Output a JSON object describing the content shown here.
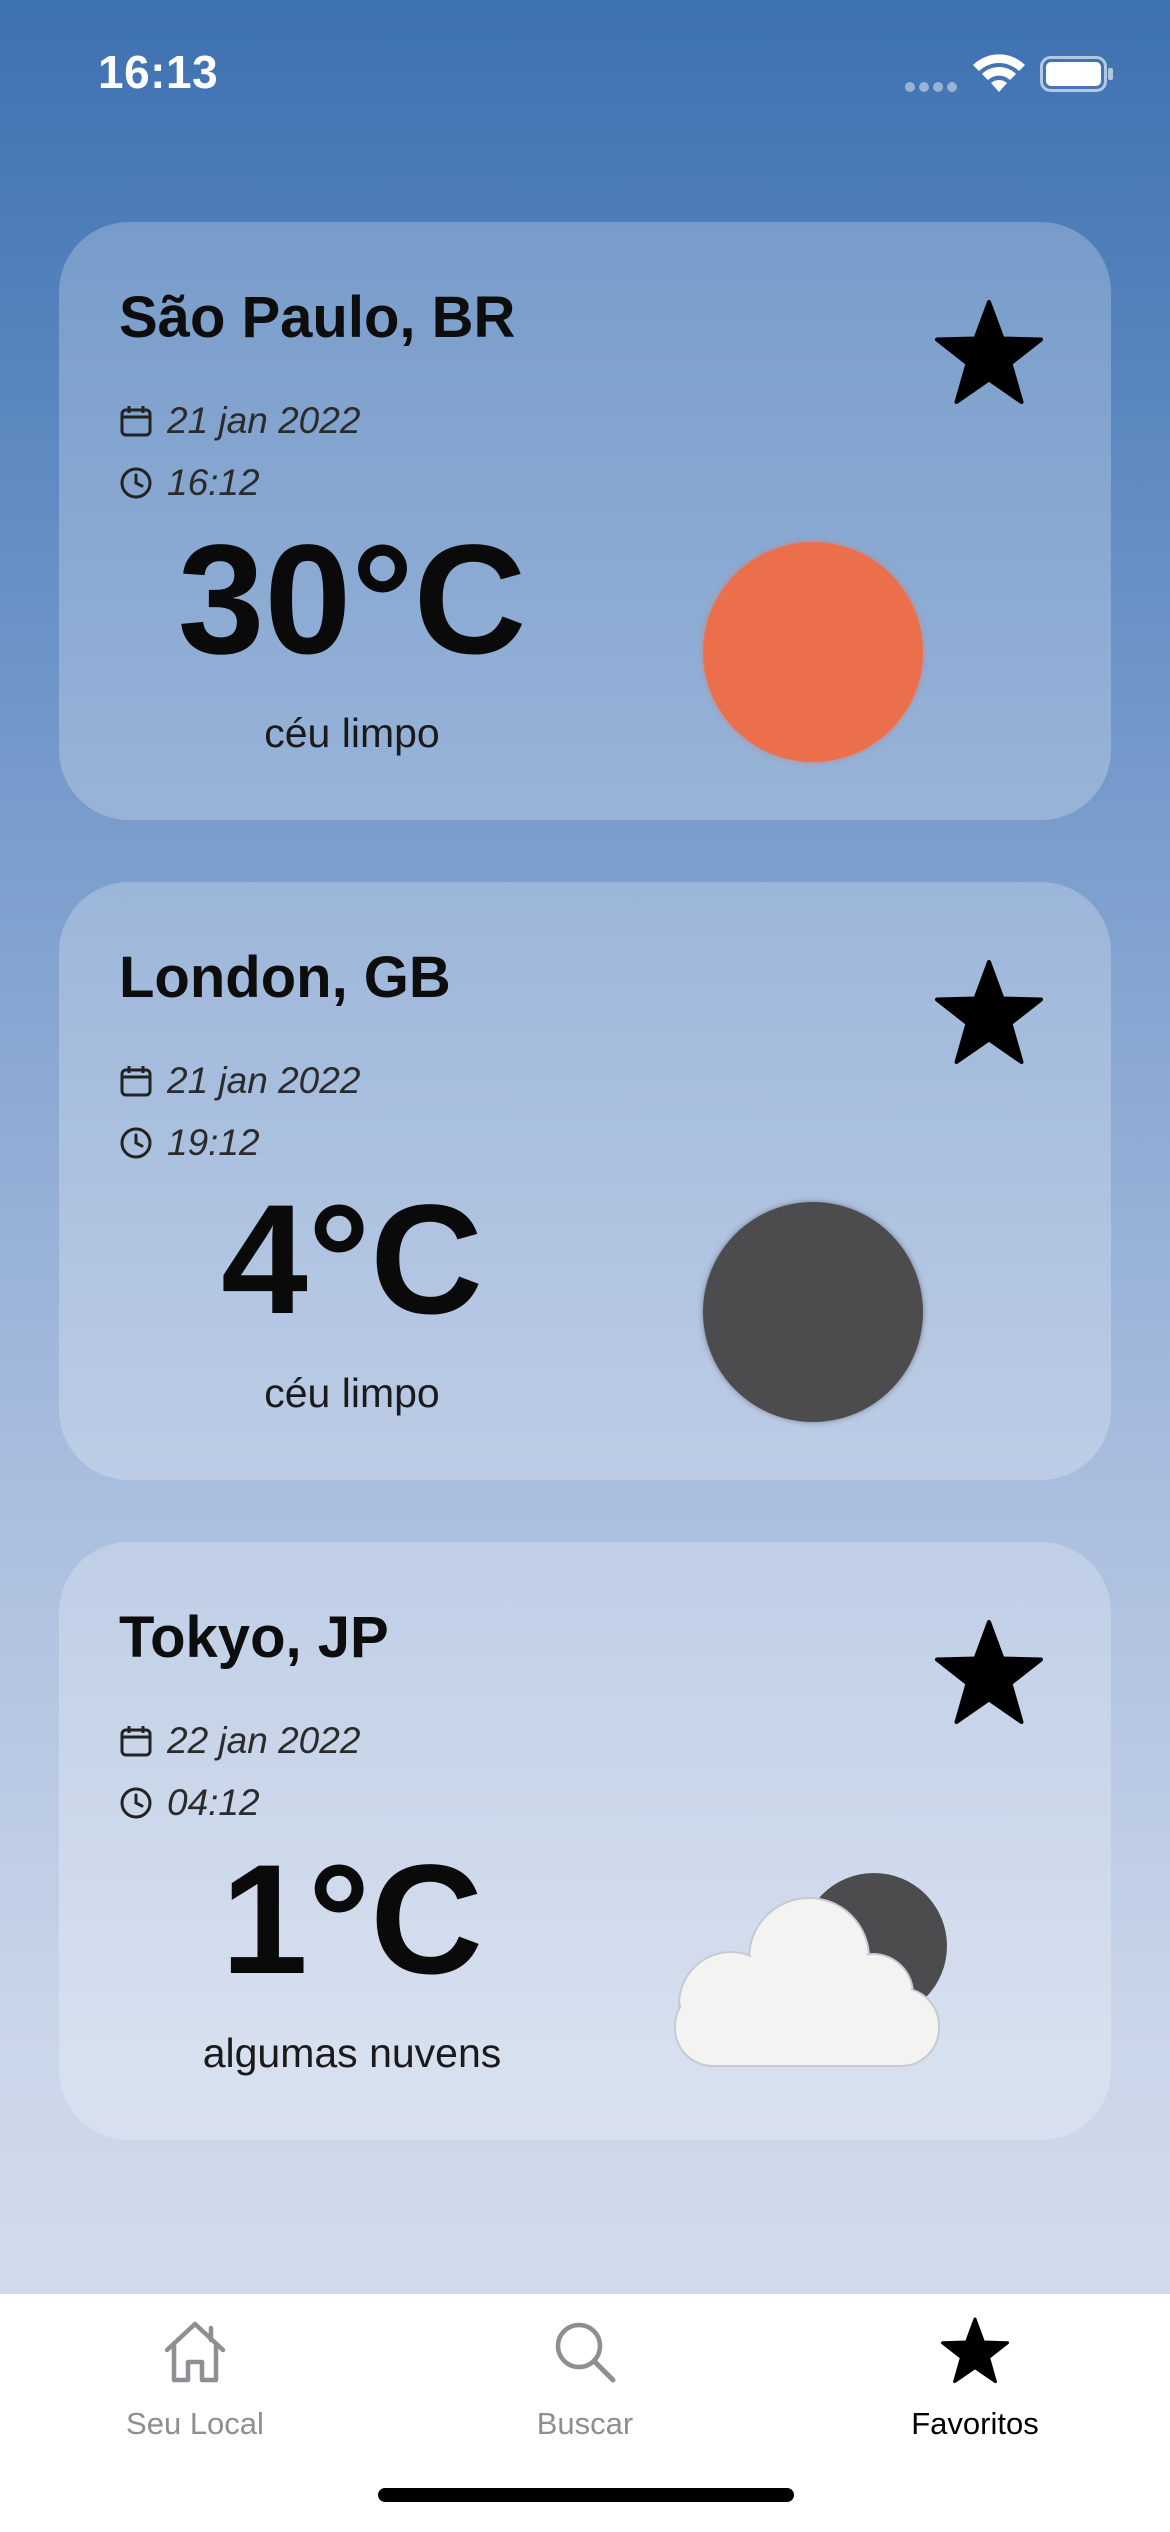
{
  "status_bar": {
    "time": "16:13"
  },
  "cards": [
    {
      "city": "São Paulo, BR",
      "date": "21 jan 2022",
      "time": "16:12",
      "temperature": "30°C",
      "description": "céu limpo",
      "icon": "sun-icon",
      "icon_color": "#ec6f4c",
      "favorite": true
    },
    {
      "city": "London, GB",
      "date": "21 jan 2022",
      "time": "19:12",
      "temperature": "4°C",
      "description": "céu limpo",
      "icon": "moon-icon",
      "icon_color": "#4c4c4e",
      "favorite": true
    },
    {
      "city": "Tokyo, JP",
      "date": "22 jan 2022",
      "time": "04:12",
      "temperature": "1°C",
      "description": "algumas nuvens",
      "icon": "cloud-night-icon",
      "favorite": true
    }
  ],
  "tab_bar": {
    "tabs": [
      {
        "label": "Seu Local",
        "icon": "home-icon",
        "active": false
      },
      {
        "label": "Buscar",
        "icon": "search-icon",
        "active": false
      },
      {
        "label": "Favoritos",
        "icon": "star-icon",
        "active": true
      }
    ]
  },
  "colors": {
    "background_top": "#3e71b2",
    "background_bottom": "#d8e0ee",
    "active_tab": "#000000",
    "inactive_tab": "#8e8e93"
  }
}
